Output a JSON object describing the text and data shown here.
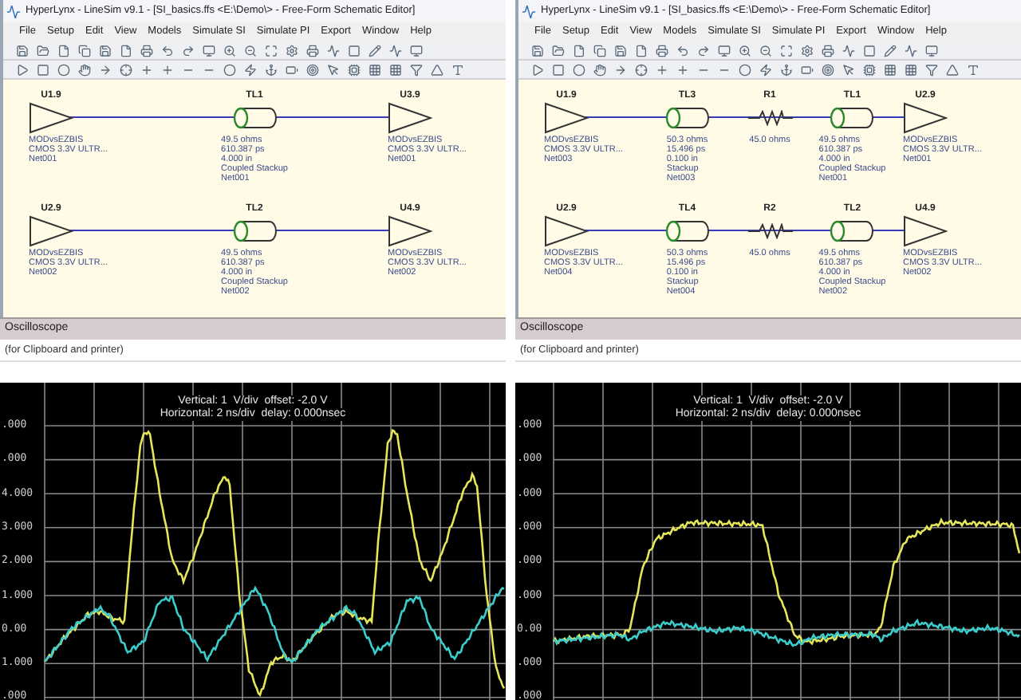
{
  "panels": [
    {
      "window_title": "HyperLynx - LineSim v9.1 - [SI_basics.ffs <E:\\Demo\\> - Free-Form Schematic Editor]",
      "menu": [
        "File",
        "Setup",
        "Edit",
        "View",
        "Models",
        "Simulate SI",
        "Simulate PI",
        "Export",
        "Window",
        "Help"
      ],
      "schematic_rows": [
        {
          "parts": [
            {
              "kind": "buffer",
              "ref": "U1.9",
              "lines": [
                "MODvsEZBIS",
                "CMOS 3.3V ULTR...",
                "Net001"
              ]
            },
            {
              "kind": "tline",
              "ref": "TL1",
              "lines": [
                "49.5 ohms",
                "610.387 ps",
                "4.000 in",
                "Coupled Stackup",
                "Net001"
              ]
            },
            {
              "kind": "buffer",
              "ref": "U3.9",
              "lines": [
                "MODvsEZBIS",
                "CMOS 3.3V ULTR...",
                "Net001"
              ]
            }
          ]
        },
        {
          "parts": [
            {
              "kind": "buffer",
              "ref": "U2.9",
              "lines": [
                "MODvsEZBIS",
                "CMOS 3.3V ULTR...",
                "Net002"
              ]
            },
            {
              "kind": "tline",
              "ref": "TL2",
              "lines": [
                "49.5 ohms",
                "610.387 ps",
                "4.000 in",
                "Coupled Stackup",
                "Net002"
              ]
            },
            {
              "kind": "buffer",
              "ref": "U4.9",
              "lines": [
                "MODvsEZBIS",
                "CMOS 3.3V ULTR...",
                "Net002"
              ]
            }
          ]
        }
      ],
      "pane_title": "Oscilloscope",
      "pane_note": "(for Clipboard and printer)",
      "scope": {
        "header": [
          "Vertical: 1  V/div  offset: -2.0 V",
          "Horizontal: 2 ns/div  delay: 0.000nsec"
        ],
        "y_labels": [
          ".000",
          ".000",
          "4.000",
          "3.000",
          "2.000",
          "1.000",
          "0.00",
          "1.000",
          ".000"
        ]
      }
    },
    {
      "window_title": "HyperLynx - LineSim v9.1 - [SI_basics.ffs <E:\\Demo\\> - Free-Form Schematic Editor]",
      "menu": [
        "File",
        "Setup",
        "Edit",
        "View",
        "Models",
        "Simulate SI",
        "Simulate PI",
        "Export",
        "Window",
        "Help"
      ],
      "schematic_rows": [
        {
          "parts": [
            {
              "kind": "buffer",
              "ref": "U1.9",
              "lines": [
                "MODvsEZBIS",
                "CMOS 3.3V ULTR...",
                "Net003"
              ]
            },
            {
              "kind": "tline",
              "ref": "TL3",
              "lines": [
                "50.3 ohms",
                "15.496 ps",
                "0.100 in",
                "Stackup",
                "Net003"
              ]
            },
            {
              "kind": "resistor",
              "ref": "R1",
              "lines": [
                "45.0 ohms"
              ]
            },
            {
              "kind": "tline",
              "ref": "TL1",
              "lines": [
                "49.5 ohms",
                "610.387 ps",
                "4.000 in",
                "Coupled Stackup",
                "Net001"
              ]
            },
            {
              "kind": "buffer",
              "ref": "U2.9",
              "lines": [
                "MODvsEZBIS",
                "CMOS 3.3V ULTR...",
                "Net001"
              ]
            }
          ]
        },
        {
          "parts": [
            {
              "kind": "buffer",
              "ref": "U2.9",
              "lines": [
                "MODvsEZBIS",
                "CMOS 3.3V ULTR...",
                "Net004"
              ]
            },
            {
              "kind": "tline",
              "ref": "TL4",
              "lines": [
                "50.3 ohms",
                "15.496 ps",
                "0.100 in",
                "Stackup",
                "Net004"
              ]
            },
            {
              "kind": "resistor",
              "ref": "R2",
              "lines": [
                "45.0 ohms"
              ]
            },
            {
              "kind": "tline",
              "ref": "TL2",
              "lines": [
                "49.5 ohms",
                "610.387 ps",
                "4.000 in",
                "Coupled Stackup",
                "Net002"
              ]
            },
            {
              "kind": "buffer",
              "ref": "U4.9",
              "lines": [
                "MODvsEZBIS",
                "CMOS 3.3V ULTR...",
                "Net002"
              ]
            }
          ]
        }
      ],
      "pane_title": "Oscilloscope",
      "pane_note": "(for Clipboard and printer)",
      "scope": {
        "header": [
          "Vertical: 1  V/div  offset: -2.0 V",
          "Horizontal: 2 ns/div  delay: 0.000nsec"
        ],
        "y_labels": [
          ".000",
          ".000",
          ".000",
          ".000",
          ".000",
          ".000",
          "0.00",
          ".000",
          ".000"
        ]
      }
    }
  ]
}
